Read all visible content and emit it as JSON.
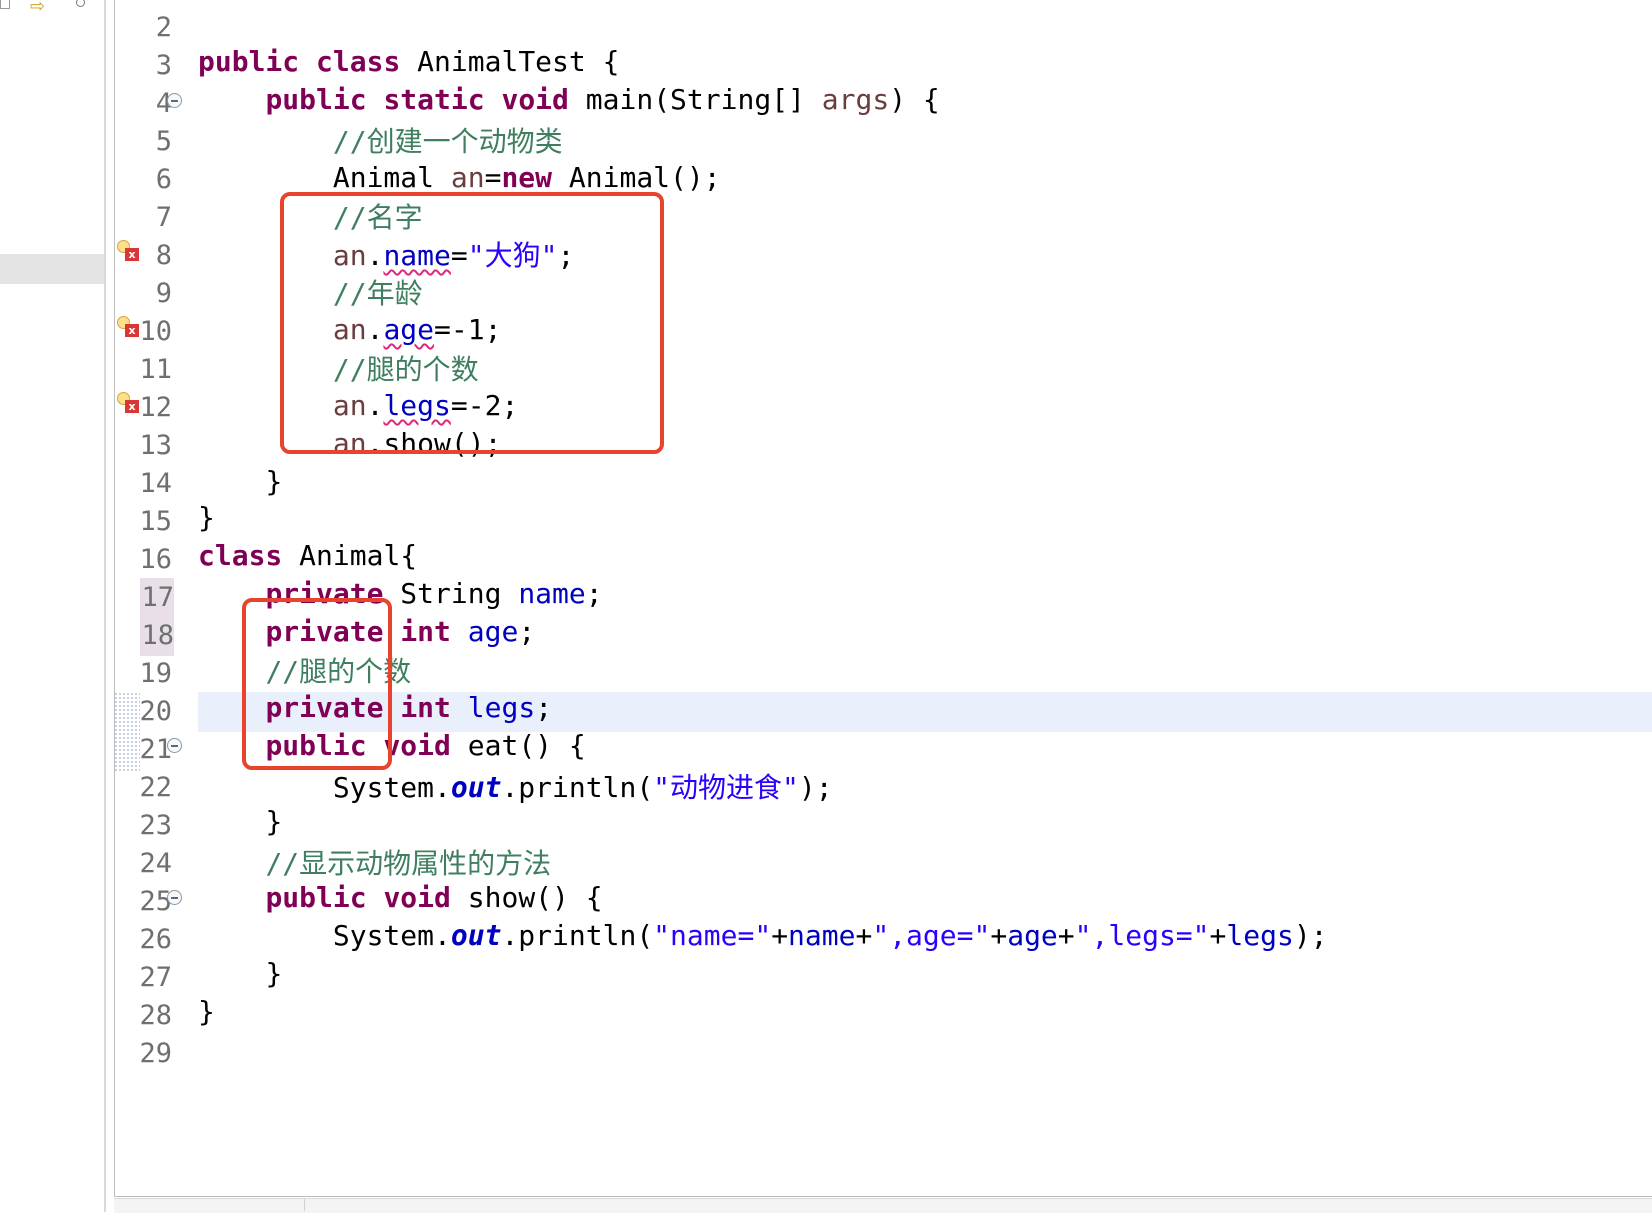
{
  "editor": {
    "lines": [
      {
        "n": "2"
      },
      {
        "n": "3"
      },
      {
        "n": "4"
      },
      {
        "n": "5"
      },
      {
        "n": "6"
      },
      {
        "n": "7"
      },
      {
        "n": "8"
      },
      {
        "n": "9"
      },
      {
        "n": "10"
      },
      {
        "n": "11"
      },
      {
        "n": "12"
      },
      {
        "n": "13"
      },
      {
        "n": "14"
      },
      {
        "n": "15"
      },
      {
        "n": "16"
      },
      {
        "n": "17"
      },
      {
        "n": "18"
      },
      {
        "n": "19"
      },
      {
        "n": "20"
      },
      {
        "n": "21"
      },
      {
        "n": "22"
      },
      {
        "n": "23"
      },
      {
        "n": "24"
      },
      {
        "n": "25"
      },
      {
        "n": "26"
      },
      {
        "n": "27"
      },
      {
        "n": "28"
      },
      {
        "n": "29"
      }
    ],
    "code": {
      "l3": {
        "kw1": "public",
        "kw2": "class",
        "rest": " AnimalTest {"
      },
      "l4": {
        "kw1": "public",
        "kw2": "static",
        "kw3": "void",
        "mid": " main(String[] ",
        "arg": "args",
        "end": ") {"
      },
      "l5": {
        "comment": "//创建一个动物类"
      },
      "l6": {
        "a": "Animal ",
        "var": "an",
        "eq": "=",
        "kw": "new",
        "rest": " Animal();"
      },
      "l7": {
        "comment": "//名字"
      },
      "l8": {
        "var": "an",
        "dot": ".",
        "field": "name",
        "eq": "=",
        "str": "\"大狗\"",
        "end": ";"
      },
      "l9": {
        "comment": "//年龄"
      },
      "l10": {
        "var": "an",
        "dot": ".",
        "field": "age",
        "rest": "=-1;"
      },
      "l11": {
        "comment": "//腿的个数"
      },
      "l12": {
        "var": "an",
        "dot": ".",
        "field": "legs",
        "rest": "=-2;"
      },
      "l13": {
        "var": "an",
        "rest": ".show();"
      },
      "l14": {
        "text": "}"
      },
      "l15": {
        "text": "}"
      },
      "l16": {
        "kw": "class",
        "rest": " Animal{"
      },
      "l17": {
        "kw": "private",
        "type": " String ",
        "field": "name",
        "end": ";"
      },
      "l18": {
        "kw": "private",
        "kw2": "int",
        "field": "age",
        "end": ";"
      },
      "l19": {
        "comment": "//腿的个数"
      },
      "l20": {
        "kw": "private",
        "kw2": "int",
        "field": "legs",
        "end": ";"
      },
      "l21": {
        "kw1": "public",
        "kw2": "void",
        "rest": " eat() {"
      },
      "l22": {
        "pre": "System.",
        "out": "out",
        "mid": ".println(",
        "str": "\"动物进食\"",
        "end": ");"
      },
      "l23": {
        "text": "}"
      },
      "l24": {
        "comment": "//显示动物属性的方法"
      },
      "l25": {
        "kw1": "public",
        "kw2": "void",
        "rest": " show() {"
      },
      "l26": {
        "pre": "System.",
        "out": "out",
        "mid": ".println(",
        "s1": "\"name=\"",
        "p1": "+",
        "f1": "name",
        "p2": "+",
        "s2": "\",age=\"",
        "p3": "+",
        "f2": "age",
        "p4": "+",
        "s3": "\",legs=\"",
        "p5": "+",
        "f3": "legs",
        "end": ");"
      },
      "l27": {
        "text": "}"
      },
      "l28": {
        "text": "}"
      }
    }
  },
  "colors": {
    "keyword": "#7f0055",
    "comment": "#3f7f5f",
    "string": "#2a00ff",
    "field": "#0000c0",
    "annotation_box": "#e8432c",
    "current_line": "#e9f0fb"
  },
  "icons": [
    "fold-collapse-icon",
    "error-bulb-icon"
  ]
}
